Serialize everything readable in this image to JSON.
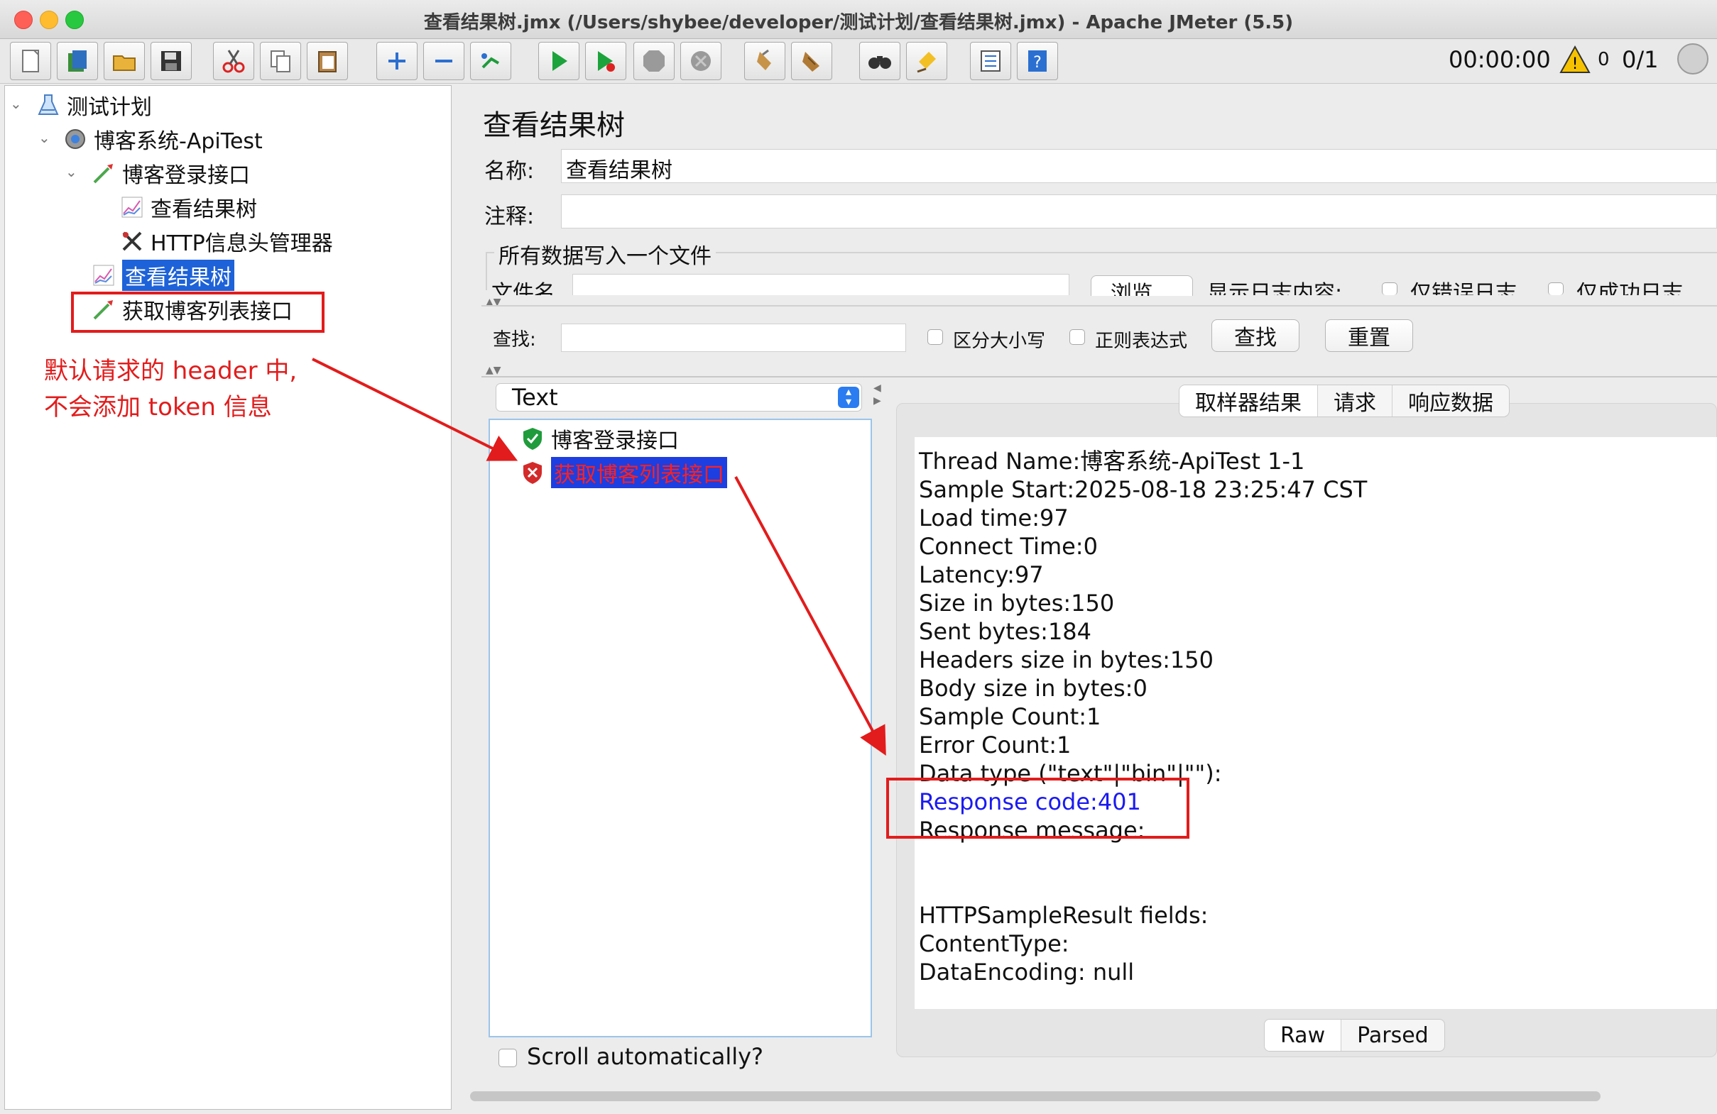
{
  "window": {
    "title": "查看结果树.jmx (/Users/shybee/developer/测试计划/查看结果树.jmx) - Apache JMeter (5.5)",
    "traffic_lights": [
      "#fe5f57",
      "#febc2e",
      "#28c840"
    ]
  },
  "toolbar": {
    "buttons": [
      "new-icon",
      "templates-icon",
      "open-icon",
      "save-icon",
      "cut-icon",
      "copy-icon",
      "paste-icon",
      "expand-icon",
      "collapse-icon",
      "toggle-icon",
      "start-icon",
      "start-no-pause-icon",
      "stop-icon",
      "shutdown-icon",
      "clear-icon",
      "clear-all-icon",
      "search-icon",
      "reset-search-icon",
      "function-helper-icon",
      "help-icon"
    ],
    "timer": "00:00:00",
    "warning_count": "0",
    "threads": "0/1"
  },
  "tree": {
    "items": [
      {
        "label": "测试计划",
        "icon": "test-plan-icon"
      },
      {
        "label": "博客系统-ApiTest",
        "icon": "thread-group-icon"
      },
      {
        "label": "博客登录接口",
        "icon": "http-sampler-icon"
      },
      {
        "label": "查看结果树",
        "icon": "listener-icon"
      },
      {
        "label": "HTTP信息头管理器",
        "icon": "header-manager-icon"
      },
      {
        "label": "查看结果树",
        "icon": "listener-icon",
        "selected": true
      },
      {
        "label": "获取博客列表接口",
        "icon": "http-sampler-icon"
      }
    ]
  },
  "annotation": {
    "text": "默认请求的 header 中,\n不会添加 token 信息",
    "color": "#e21c1c"
  },
  "panel": {
    "title": "查看结果树",
    "name_label": "名称:",
    "name_value": "查看结果树",
    "comment_label": "注释:",
    "comment_value": "",
    "file_group_title": "所有数据写入一个文件",
    "filename_label": "文件名",
    "browse_label": "浏览...",
    "log_content_label": "显示日志内容:",
    "errors_only_label": "仅错误日志",
    "success_only_label": "仅成功日志"
  },
  "search": {
    "label": "查找:",
    "value": "",
    "case_label": "区分大小写",
    "regex_label": "正则表达式",
    "find_button": "查找",
    "reset_button": "重置"
  },
  "results": {
    "renderer": "Text",
    "items": [
      {
        "label": "博客登录接口",
        "status": "success"
      },
      {
        "label": "获取博客列表接口",
        "status": "failure"
      }
    ],
    "scroll_auto_label": "Scroll automatically?"
  },
  "tabs": [
    "取样器结果",
    "请求",
    "响应数据"
  ],
  "details": {
    "lines": [
      "Thread Name:博客系统-ApiTest 1-1",
      "Sample Start:2025-08-18 23:25:47 CST",
      "Load time:97",
      "Connect Time:0",
      "Latency:97",
      "Size in bytes:150",
      "Sent bytes:184",
      "Headers size in bytes:150",
      "Body size in bytes:0",
      "Sample Count:1",
      "Error Count:1",
      "Data type (\"text\"|\"bin\"|\"\"):",
      "Response code:401",
      "Response message:",
      "",
      "",
      "HTTPSampleResult fields:",
      "ContentType:",
      "DataEncoding: null"
    ]
  },
  "view_toggle": [
    "Raw",
    "Parsed"
  ]
}
